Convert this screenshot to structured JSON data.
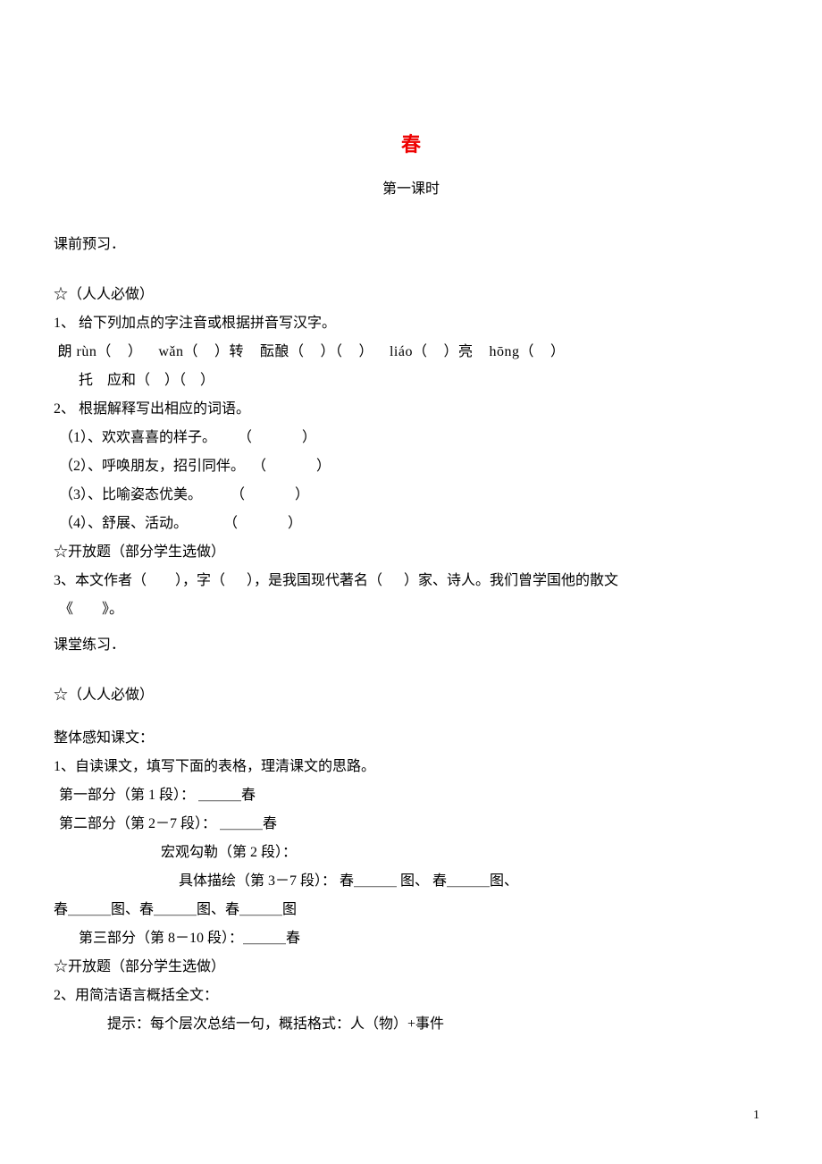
{
  "title": "春",
  "subtitle": "第一课时",
  "preclass_header": "课前预习．",
  "required_label": "☆（人人必做）",
  "optional_label": "☆开放题（部分学生选做）",
  "q1_header": "1、 给下列加点的字注音或根据拼音写汉字。",
  "q1_line1": " 朗 rùn（    ）    wǎn（    ）转    酝酿（    ）（    ）    liáo（    ）亮    hōng（    ）",
  "q1_line2": "托    应和（    ）（    ）",
  "q2_header": "2、 根据解释写出相应的词语。",
  "q2_items": [
    "（1）、欢欢喜喜的样子。      （              ）",
    "（2）、呼唤朋友，招引同伴。  （              ）",
    "（3）、比喻姿态优美。        （              ）",
    "（4）、舒展、活动。          （              ）"
  ],
  "q3_line1": "3、本文作者（        ），字（      ），是我国现代著名（      ）家、诗人。我们曾学国他的散文",
  "q3_line2": "《        》。",
  "inclass_header": "课堂练习．",
  "perceive_header": "整体感知课文：",
  "iq1_header": "1、自读课文，填写下面的表格，理清课文的思路。",
  "iq1_lines": [
    "第一部分（第 1 段）： ＿＿＿春",
    "第二部分（第 2－7 段）： ＿＿＿春"
  ],
  "iq1_macro": "宏观勾勒（第 2 段）：",
  "iq1_detail": "具体描绘（第 3－7 段）： 春＿＿＿ 图、  春＿＿＿图、",
  "iq1_extra": "春＿＿＿图、春＿＿＿图、春＿＿＿图",
  "iq1_part3": "第三部分（第 8－10 段）：＿＿＿春",
  "iq2_header": "2、用简洁语言概括全文：",
  "iq2_hint": "提示：每个层次总结一句，概括格式：人（物）+事件",
  "page_number": "1"
}
